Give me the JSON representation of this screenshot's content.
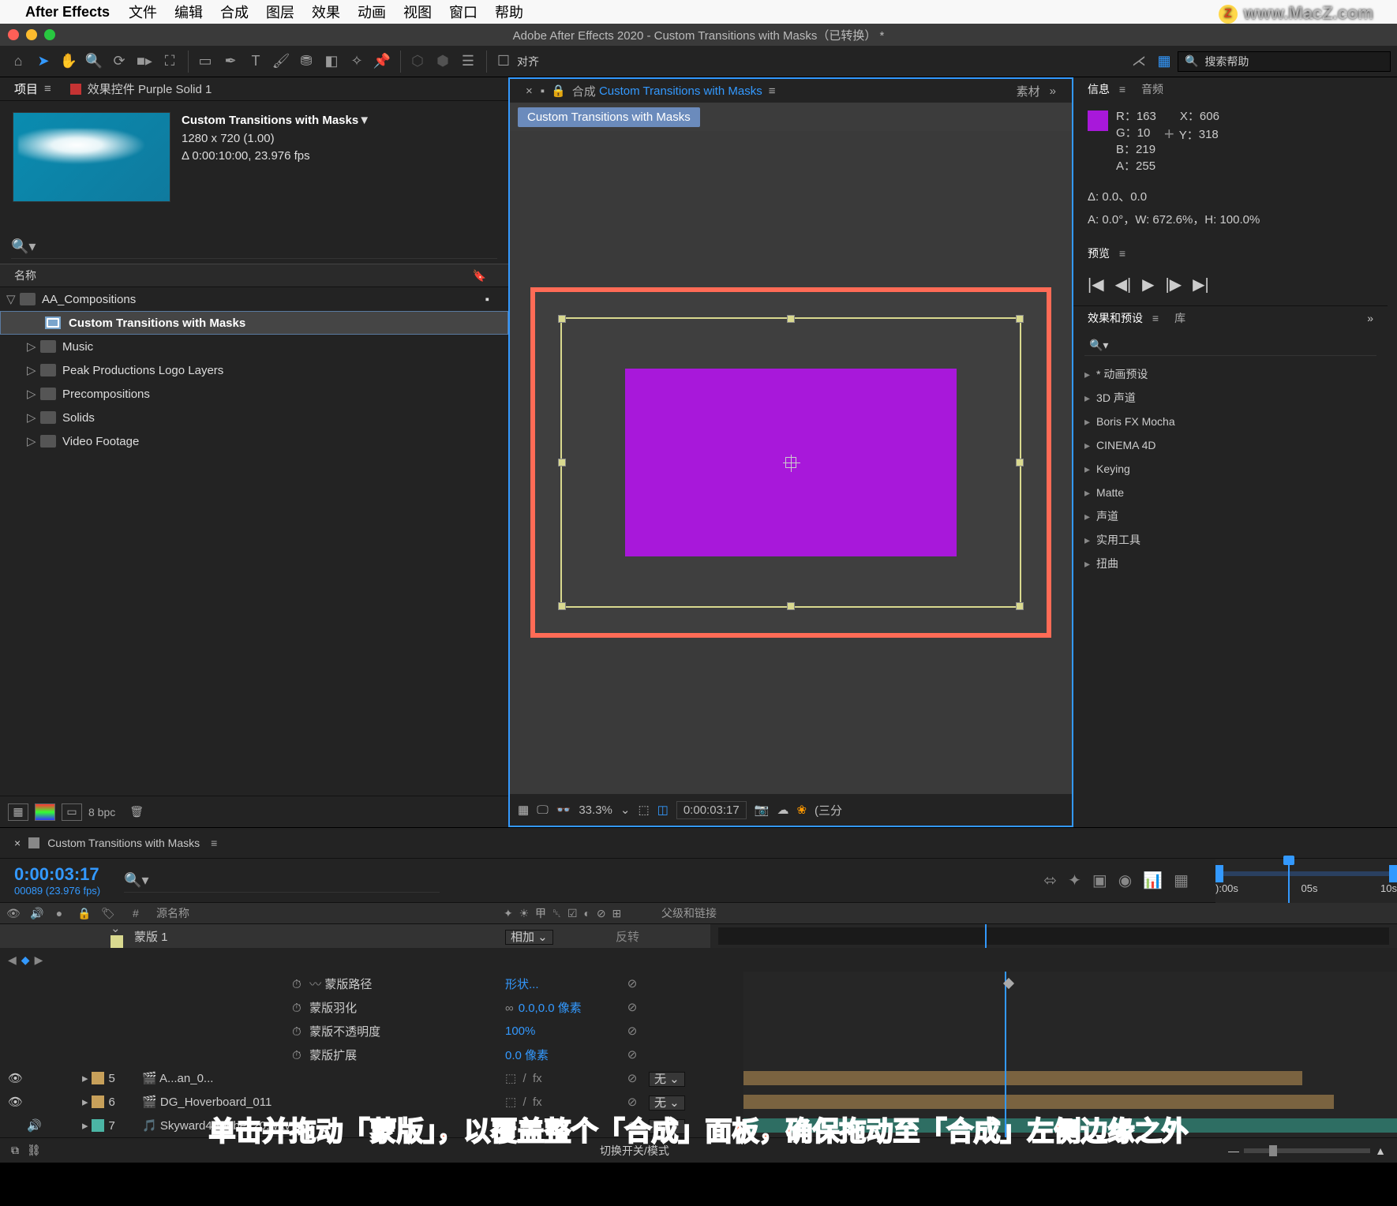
{
  "menubar": {
    "app": "After Effects",
    "items": [
      "文件",
      "编辑",
      "合成",
      "图层",
      "效果",
      "动画",
      "视图",
      "窗口",
      "帮助"
    ]
  },
  "watermark": "www.MacZ.com",
  "titlebar": "Adobe After Effects 2020 - Custom Transitions with Masks（已转换） *",
  "toolbar": {
    "align": "对齐",
    "search_placeholder": "搜索帮助"
  },
  "project": {
    "tab1": "项目",
    "tab2": "效果控件 Purple Solid 1",
    "comp_name": "Custom Transitions with Masks",
    "arrow": "▼",
    "dims": "1280 x 720 (1.00)",
    "dur": "Δ 0:00:10:00, 23.976 fps",
    "col_name": "名称",
    "items": [
      {
        "tw": "▽",
        "type": "fold",
        "label": "AA_Compositions",
        "sel": false
      },
      {
        "tw": "",
        "type": "comp",
        "label": "Custom Transitions with Masks",
        "sel": true,
        "sub": true
      },
      {
        "tw": "▷",
        "type": "fold",
        "label": "Music"
      },
      {
        "tw": "▷",
        "type": "fold",
        "label": "Peak Productions Logo Layers"
      },
      {
        "tw": "▷",
        "type": "fold",
        "label": "Precompositions"
      },
      {
        "tw": "▷",
        "type": "fold",
        "label": "Solids"
      },
      {
        "tw": "▷",
        "type": "fold",
        "label": "Video Footage"
      }
    ],
    "bpc": "8 bpc"
  },
  "composition": {
    "tab_prefix": "合成",
    "tab_name": "Custom Transitions with Masks",
    "crumb": "Custom Transitions with Masks",
    "tab_right": "素材",
    "zoom": "33.3%",
    "time": "0:00:03:17",
    "res": "(三分"
  },
  "info": {
    "tab1": "信息",
    "tab2": "音频",
    "R": "R：",
    "Rv": "163",
    "G": "G：",
    "Gv": "10",
    "B": "B：",
    "Bv": "219",
    "A": "A：",
    "Av": "255",
    "X": "X：",
    "Xv": "606",
    "Y": "Y：",
    "Yv": "318",
    "delta": "Δ: 0.0、0.0",
    "ai": "A: 0.0°，W: 672.6%，H: 100.0%"
  },
  "preview": {
    "tab": "预览"
  },
  "effects": {
    "tab1": "效果和预设",
    "tab2": "库",
    "items": [
      "* 动画预设",
      "3D 声道",
      "Boris FX Mocha",
      "CINEMA 4D",
      "Keying",
      "Matte",
      "声道",
      "实用工具",
      "扭曲"
    ]
  },
  "timeline": {
    "tab": "Custom Transitions with Masks",
    "timecode": "0:00:03:17",
    "sub": "00089 (23.976 fps)",
    "col_num": "#",
    "col_src": "源名称",
    "col_parent": "父级和链接",
    "ruler_labels": [
      "):00s",
      "05s",
      "10s"
    ],
    "mask_label": "蒙版 1",
    "mask_mode": "相加",
    "mask_inv": "反转",
    "props": [
      {
        "name": "蒙版路径",
        "val": "形状...",
        "kf": true
      },
      {
        "name": "蒙版羽化",
        "val": "0.0,0.0 像素",
        "link": "∞"
      },
      {
        "name": "蒙版不透明度",
        "val": "100%"
      },
      {
        "name": "蒙版扩展",
        "val": "0.0 像素"
      }
    ],
    "layers": [
      {
        "num": "5",
        "name": "A...an_0...",
        "color": "#c7a05a",
        "par": "无"
      },
      {
        "num": "6",
        "name": "DG_Hoverboard_011",
        "color": "#c7a05a",
        "par": "无"
      },
      {
        "num": "7",
        "name": "Skyward4Adobe120.wav",
        "color": "#4bb5a5",
        "par": "无"
      }
    ],
    "foot": "切换开关/模式"
  },
  "annotation": "单击并拖动「蒙版」，以覆盖整个「合成」面板，确保拖动至「合成」左侧边缘之外"
}
